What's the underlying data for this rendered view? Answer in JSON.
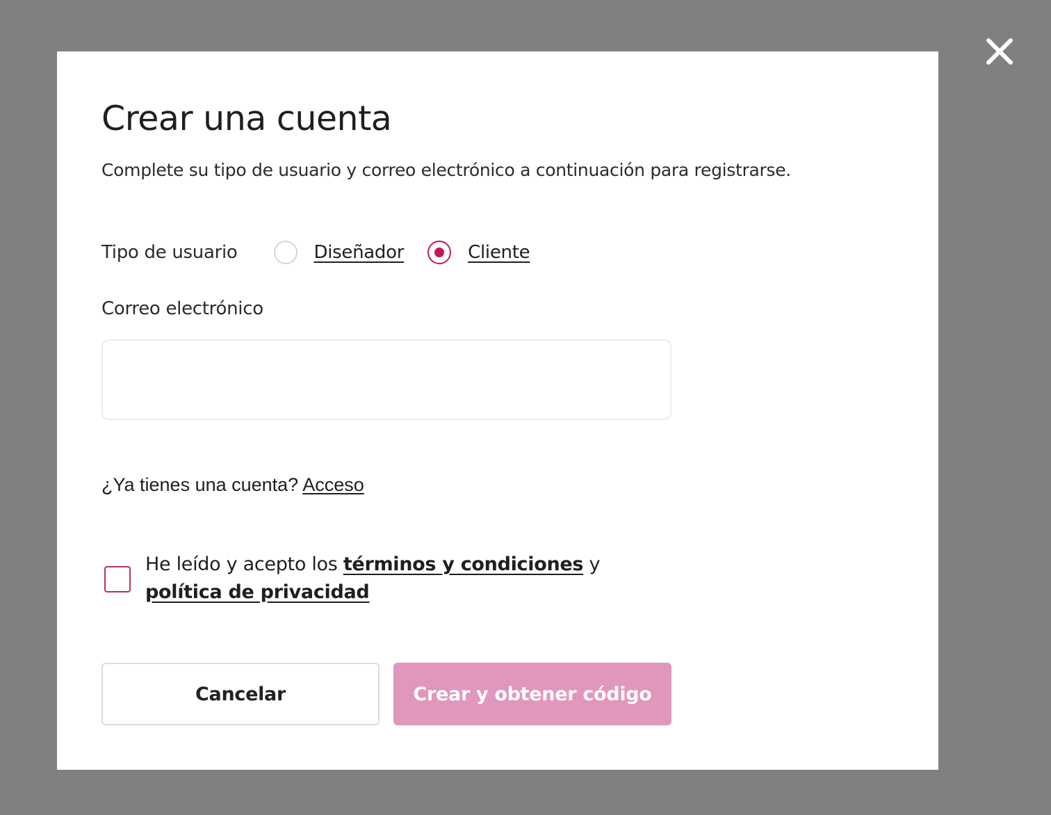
{
  "modal": {
    "title": "Crear una cuenta",
    "subtitle": "Complete su tipo de usuario y correo electrónico a continuación para registrarse."
  },
  "user_type": {
    "label": "Tipo de usuario",
    "options": [
      {
        "label": "Diseñador",
        "selected": false
      },
      {
        "label": "Cliente",
        "selected": true
      }
    ]
  },
  "email": {
    "label": "Correo electrónico",
    "value": "",
    "placeholder": ""
  },
  "login_prompt": {
    "text": "¿Ya tienes una cuenta?",
    "link": "Acceso"
  },
  "terms": {
    "checked": false,
    "prefix": "He leído y acepto los",
    "terms_link": "términos y condiciones",
    "joiner": "y",
    "privacy_link": "política de privacidad"
  },
  "buttons": {
    "cancel": "Cancelar",
    "create": "Crear y obtener código"
  },
  "colors": {
    "overlay": "#808080",
    "accent": "#c2185b",
    "create_button_disabled": "#e196bd"
  },
  "icons": {
    "close": "close-icon"
  }
}
